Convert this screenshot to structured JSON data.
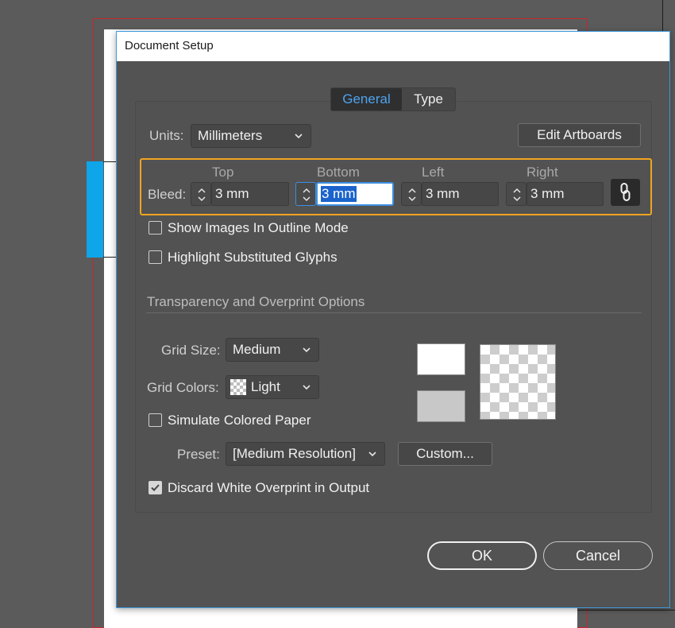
{
  "dialog": {
    "title": "Document Setup"
  },
  "tabs": [
    {
      "label": "General",
      "active": true
    },
    {
      "label": "Type",
      "active": false
    }
  ],
  "units": {
    "label": "Units:",
    "value": "Millimeters"
  },
  "edit_artboards_label": "Edit Artboards",
  "bleed": {
    "label": "Bleed:",
    "columns": [
      {
        "label": "Top",
        "value": "3 mm",
        "focused": false
      },
      {
        "label": "Bottom",
        "value": "3 mm",
        "focused": true
      },
      {
        "label": "Left",
        "value": "3 mm",
        "focused": false
      },
      {
        "label": "Right",
        "value": "3 mm",
        "focused": false
      }
    ],
    "link_icon": "link-icon"
  },
  "options": {
    "show_images_outline": {
      "label": "Show Images In Outline Mode",
      "checked": false
    },
    "highlight_substituted": {
      "label": "Highlight Substituted Glyphs",
      "checked": false
    }
  },
  "transparency": {
    "section_title": "Transparency and Overprint Options",
    "grid_size": {
      "label": "Grid Size:",
      "value": "Medium"
    },
    "grid_colors": {
      "label": "Grid Colors:",
      "value": "Light"
    },
    "simulate_paper": {
      "label": "Simulate Colored Paper",
      "checked": false
    },
    "preset": {
      "label": "Preset:",
      "value": "[Medium Resolution]"
    },
    "custom_label": "Custom...",
    "discard_white": {
      "label": "Discard White Overprint in Output",
      "checked": true
    }
  },
  "buttons": {
    "ok": "OK",
    "cancel": "Cancel"
  },
  "colors": {
    "accent": "#4da3f0",
    "highlight_border": "#f1a41f",
    "dialog_bg": "#535353",
    "selection": "#1b63cc"
  }
}
